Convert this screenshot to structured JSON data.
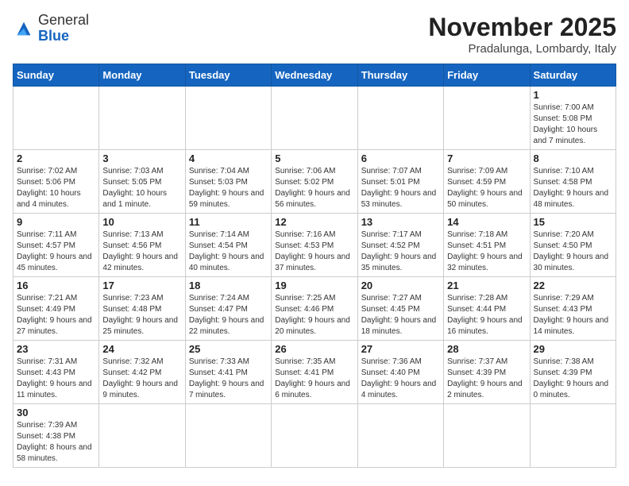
{
  "header": {
    "logo_general": "General",
    "logo_blue": "Blue",
    "month_title": "November 2025",
    "location": "Pradalunga, Lombardy, Italy"
  },
  "weekdays": [
    "Sunday",
    "Monday",
    "Tuesday",
    "Wednesday",
    "Thursday",
    "Friday",
    "Saturday"
  ],
  "weeks": [
    [
      {
        "day": "",
        "info": ""
      },
      {
        "day": "",
        "info": ""
      },
      {
        "day": "",
        "info": ""
      },
      {
        "day": "",
        "info": ""
      },
      {
        "day": "",
        "info": ""
      },
      {
        "day": "",
        "info": ""
      },
      {
        "day": "1",
        "info": "Sunrise: 7:00 AM\nSunset: 5:08 PM\nDaylight: 10 hours\nand 7 minutes."
      }
    ],
    [
      {
        "day": "2",
        "info": "Sunrise: 7:02 AM\nSunset: 5:06 PM\nDaylight: 10 hours\nand 4 minutes."
      },
      {
        "day": "3",
        "info": "Sunrise: 7:03 AM\nSunset: 5:05 PM\nDaylight: 10 hours\nand 1 minute."
      },
      {
        "day": "4",
        "info": "Sunrise: 7:04 AM\nSunset: 5:03 PM\nDaylight: 9 hours\nand 59 minutes."
      },
      {
        "day": "5",
        "info": "Sunrise: 7:06 AM\nSunset: 5:02 PM\nDaylight: 9 hours\nand 56 minutes."
      },
      {
        "day": "6",
        "info": "Sunrise: 7:07 AM\nSunset: 5:01 PM\nDaylight: 9 hours\nand 53 minutes."
      },
      {
        "day": "7",
        "info": "Sunrise: 7:09 AM\nSunset: 4:59 PM\nDaylight: 9 hours\nand 50 minutes."
      },
      {
        "day": "8",
        "info": "Sunrise: 7:10 AM\nSunset: 4:58 PM\nDaylight: 9 hours\nand 48 minutes."
      }
    ],
    [
      {
        "day": "9",
        "info": "Sunrise: 7:11 AM\nSunset: 4:57 PM\nDaylight: 9 hours\nand 45 minutes."
      },
      {
        "day": "10",
        "info": "Sunrise: 7:13 AM\nSunset: 4:56 PM\nDaylight: 9 hours\nand 42 minutes."
      },
      {
        "day": "11",
        "info": "Sunrise: 7:14 AM\nSunset: 4:54 PM\nDaylight: 9 hours\nand 40 minutes."
      },
      {
        "day": "12",
        "info": "Sunrise: 7:16 AM\nSunset: 4:53 PM\nDaylight: 9 hours\nand 37 minutes."
      },
      {
        "day": "13",
        "info": "Sunrise: 7:17 AM\nSunset: 4:52 PM\nDaylight: 9 hours\nand 35 minutes."
      },
      {
        "day": "14",
        "info": "Sunrise: 7:18 AM\nSunset: 4:51 PM\nDaylight: 9 hours\nand 32 minutes."
      },
      {
        "day": "15",
        "info": "Sunrise: 7:20 AM\nSunset: 4:50 PM\nDaylight: 9 hours\nand 30 minutes."
      }
    ],
    [
      {
        "day": "16",
        "info": "Sunrise: 7:21 AM\nSunset: 4:49 PM\nDaylight: 9 hours\nand 27 minutes."
      },
      {
        "day": "17",
        "info": "Sunrise: 7:23 AM\nSunset: 4:48 PM\nDaylight: 9 hours\nand 25 minutes."
      },
      {
        "day": "18",
        "info": "Sunrise: 7:24 AM\nSunset: 4:47 PM\nDaylight: 9 hours\nand 22 minutes."
      },
      {
        "day": "19",
        "info": "Sunrise: 7:25 AM\nSunset: 4:46 PM\nDaylight: 9 hours\nand 20 minutes."
      },
      {
        "day": "20",
        "info": "Sunrise: 7:27 AM\nSunset: 4:45 PM\nDaylight: 9 hours\nand 18 minutes."
      },
      {
        "day": "21",
        "info": "Sunrise: 7:28 AM\nSunset: 4:44 PM\nDaylight: 9 hours\nand 16 minutes."
      },
      {
        "day": "22",
        "info": "Sunrise: 7:29 AM\nSunset: 4:43 PM\nDaylight: 9 hours\nand 14 minutes."
      }
    ],
    [
      {
        "day": "23",
        "info": "Sunrise: 7:31 AM\nSunset: 4:43 PM\nDaylight: 9 hours\nand 11 minutes."
      },
      {
        "day": "24",
        "info": "Sunrise: 7:32 AM\nSunset: 4:42 PM\nDaylight: 9 hours\nand 9 minutes."
      },
      {
        "day": "25",
        "info": "Sunrise: 7:33 AM\nSunset: 4:41 PM\nDaylight: 9 hours\nand 7 minutes."
      },
      {
        "day": "26",
        "info": "Sunrise: 7:35 AM\nSunset: 4:41 PM\nDaylight: 9 hours\nand 6 minutes."
      },
      {
        "day": "27",
        "info": "Sunrise: 7:36 AM\nSunset: 4:40 PM\nDaylight: 9 hours\nand 4 minutes."
      },
      {
        "day": "28",
        "info": "Sunrise: 7:37 AM\nSunset: 4:39 PM\nDaylight: 9 hours\nand 2 minutes."
      },
      {
        "day": "29",
        "info": "Sunrise: 7:38 AM\nSunset: 4:39 PM\nDaylight: 9 hours\nand 0 minutes."
      }
    ],
    [
      {
        "day": "30",
        "info": "Sunrise: 7:39 AM\nSunset: 4:38 PM\nDaylight: 8 hours\nand 58 minutes."
      },
      {
        "day": "",
        "info": ""
      },
      {
        "day": "",
        "info": ""
      },
      {
        "day": "",
        "info": ""
      },
      {
        "day": "",
        "info": ""
      },
      {
        "day": "",
        "info": ""
      },
      {
        "day": "",
        "info": ""
      }
    ]
  ]
}
